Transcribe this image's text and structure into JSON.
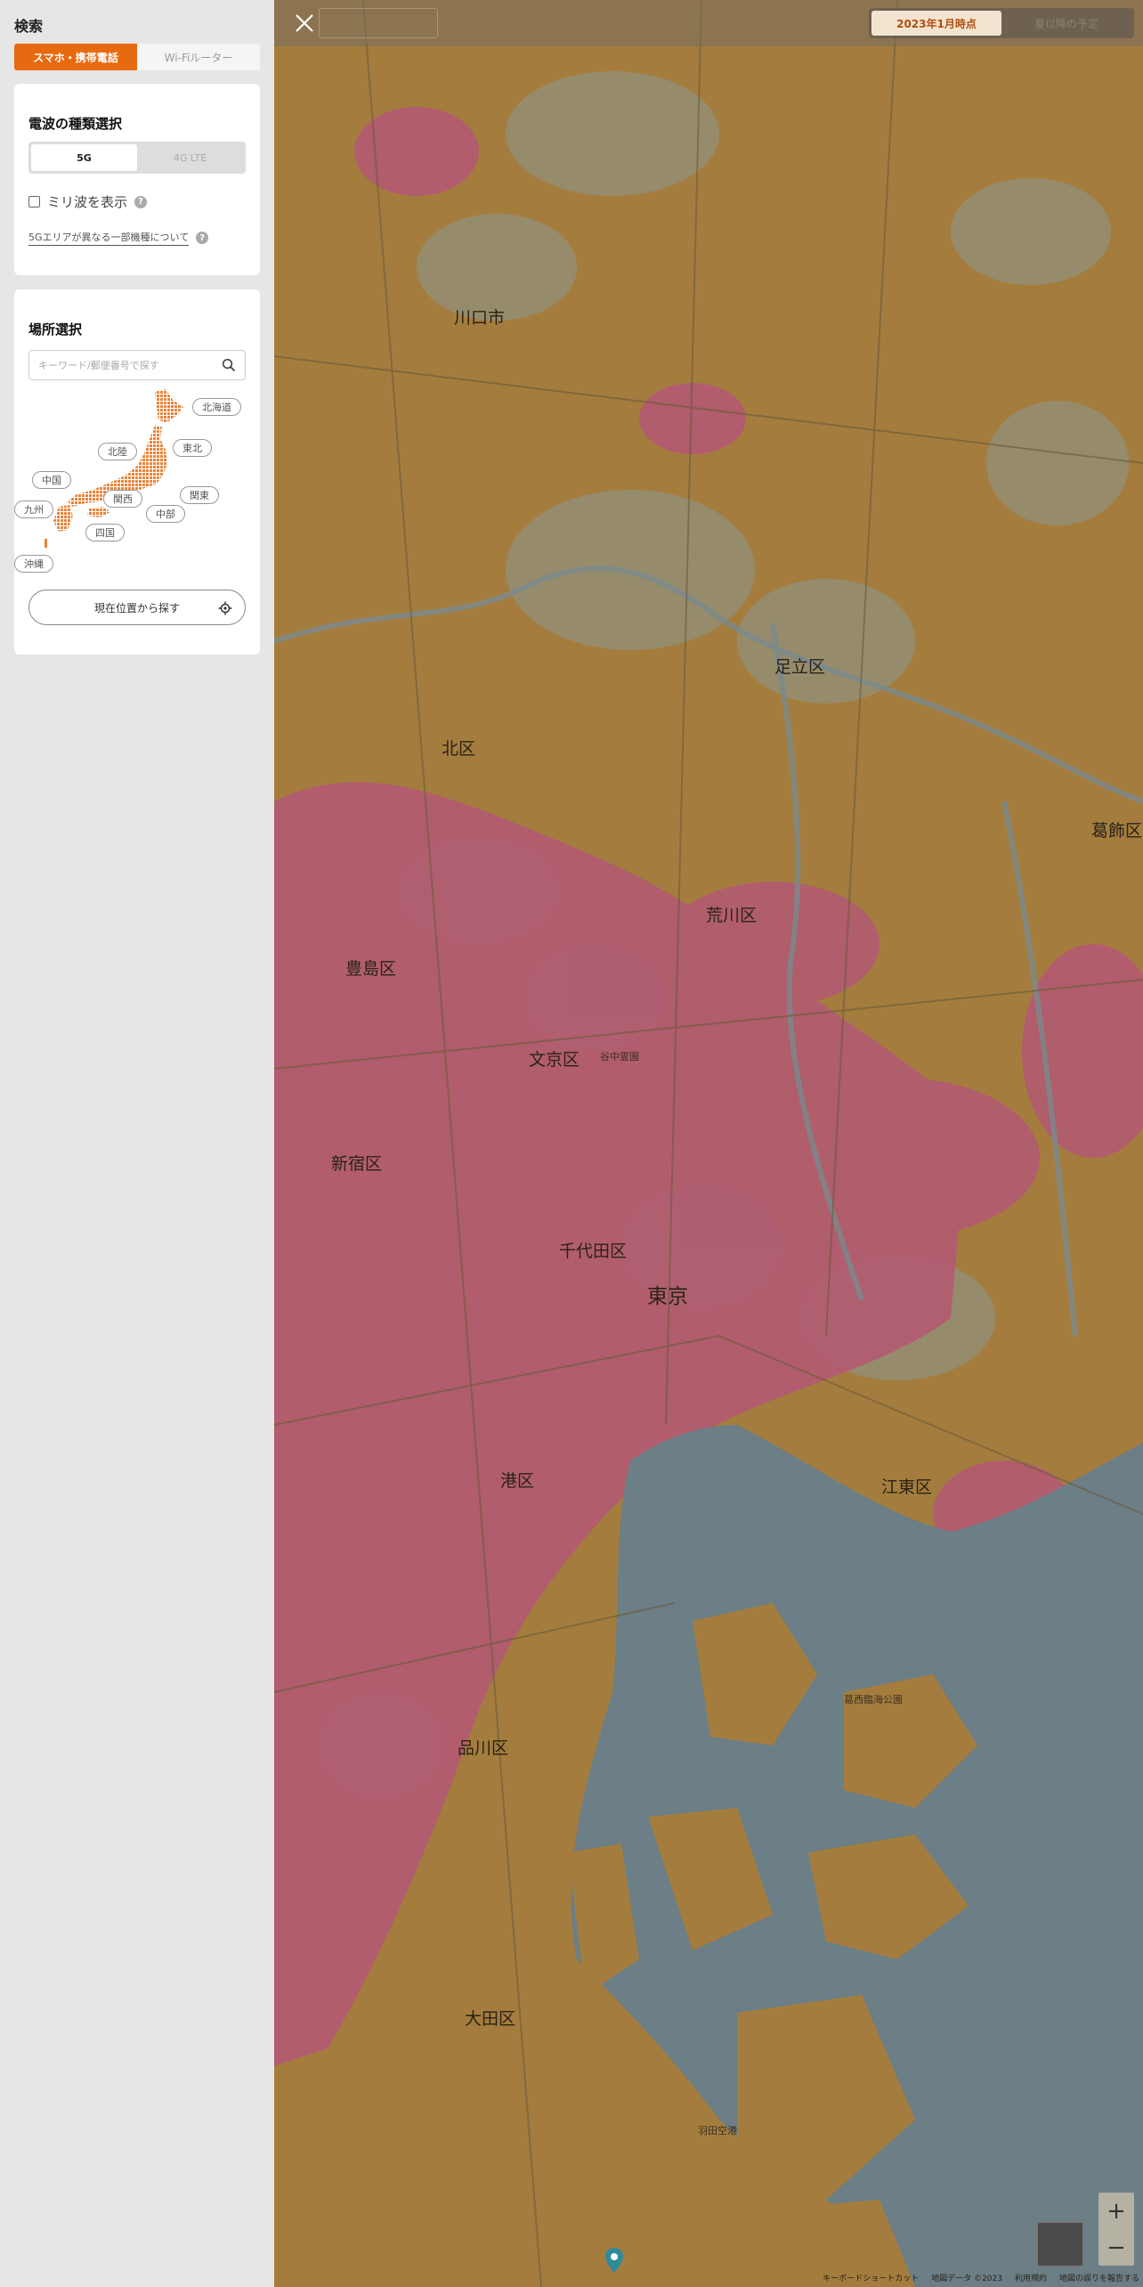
{
  "sidebar": {
    "title": "検索",
    "device_tabs": [
      {
        "label": "スマホ・携帯電話",
        "active": true
      },
      {
        "label": "Wi-Fiルーター",
        "active": false
      }
    ],
    "wave": {
      "title": "電波の種類選択",
      "options": [
        {
          "label": "5G",
          "active": true
        },
        {
          "label": "4G LTE",
          "active": false
        }
      ],
      "mmwave_label": "ミリ波を表示",
      "mmwave_checked": false,
      "help_glyph": "?",
      "link_label": "5Gエリアが異なる一部機種について"
    },
    "place": {
      "title": "場所選択",
      "search_placeholder": "キーワード/郵便番号で探す",
      "regions": [
        "北海道",
        "東北",
        "北陸",
        "関東",
        "中国",
        "関西",
        "中部",
        "九州",
        "四国",
        "沖縄"
      ],
      "locate_label": "現在位置から探す"
    }
  },
  "map": {
    "period_options": [
      {
        "label": "2023年1月時点",
        "active": true
      },
      {
        "label": "夏以降の予定",
        "active": false
      }
    ],
    "place_labels": [
      "川口市",
      "足立区",
      "北区",
      "荒川区",
      "葛飾区",
      "豊島区",
      "文京区",
      "新宿区",
      "千代田区",
      "東京",
      "港区",
      "江東区",
      "品川区",
      "大田区",
      "谷中霊園",
      "葛西臨海公園",
      "羽田空港"
    ],
    "zoom_in": "+",
    "zoom_out": "−",
    "attribution": [
      "キーボードショートカット",
      "地図データ ©2023",
      "利用規約",
      "地図の誤りを報告する"
    ],
    "colors": {
      "coverage": "#a47d3e",
      "hotspot": "#b25a72",
      "water": "#6c7e86",
      "urban": "#948e74"
    }
  }
}
